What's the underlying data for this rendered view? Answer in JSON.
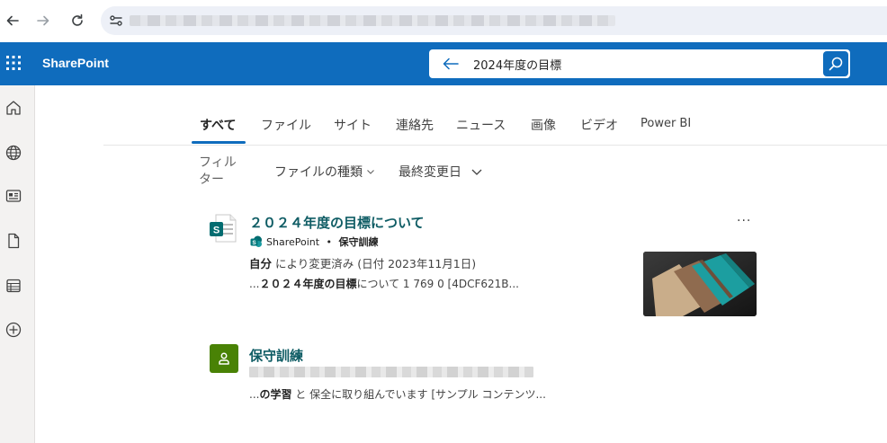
{
  "browser": {
    "back_icon": "arrow-left-icon",
    "forward_icon": "arrow-right-icon",
    "reload_icon": "reload-icon"
  },
  "suite": {
    "brand": "SharePoint",
    "accent": "#0f6cbd",
    "search_query": "2024年度の目標"
  },
  "tabs": [
    {
      "label": "すべて",
      "active": true
    },
    {
      "label": "ファイル"
    },
    {
      "label": "サイト"
    },
    {
      "label": "連絡先"
    },
    {
      "label": "ニュース"
    },
    {
      "label": "画像"
    },
    {
      "label": "ビデオ"
    },
    {
      "label": "Power BI"
    }
  ],
  "filters": {
    "label": "フィルター",
    "file_type": "ファイルの種類",
    "last_modified": "最終変更日"
  },
  "results": [
    {
      "title": "２０２４年度の目標について",
      "source_site": "SharePoint",
      "source_separator": " • ",
      "source_name": "保守訓練",
      "meta_author": "自分",
      "meta_rest": " により変更済み (日付 2023年11月1日)",
      "snippet_prefix": "...",
      "snippet_bold": "２０２４年度の目標",
      "snippet_rest": "について 1 769 0 [4DCF621B...",
      "more": "···"
    },
    {
      "title": "保守訓練",
      "snippet_prefix": "...",
      "snippet_bold": "の学習",
      "snippet_mid": " と ",
      "snippet_rest": "保全に取り組んでいます [サンプル コンテンツ..."
    }
  ]
}
